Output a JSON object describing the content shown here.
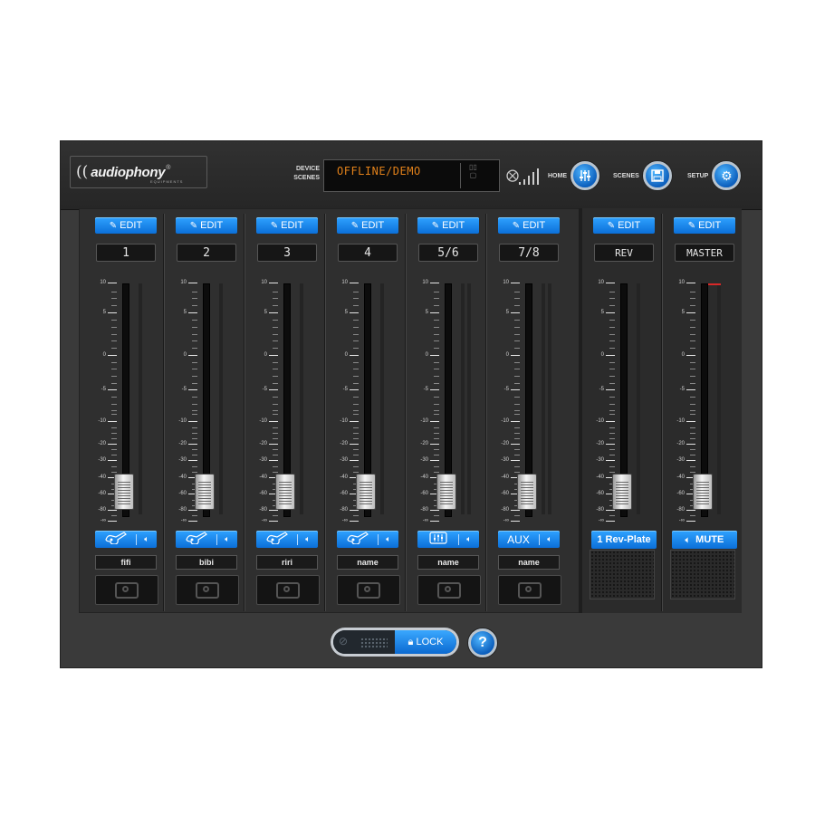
{
  "brand": {
    "logo_mark": "((",
    "logo_text": "audiophony",
    "logo_reg": "®",
    "logo_sub": "EQUIPMENTS"
  },
  "header": {
    "device_label_1": "DEVICE",
    "device_label_2": "SCENES",
    "display_text": "OFFLINE/DEMO",
    "bluetooth_icon": "⨂",
    "home_label": "HOME",
    "scenes_label": "SCENES",
    "setup_label": "SETUP"
  },
  "edit_label": "EDIT",
  "scale_labels": [
    "10",
    "5",
    "0",
    "-5",
    "-10",
    "-20",
    "-30",
    "-40",
    "-60",
    "-80",
    "-∞"
  ],
  "channels": [
    {
      "name": "1",
      "source": "guitar-icon",
      "label": "fifi"
    },
    {
      "name": "2",
      "source": "guitar-icon",
      "label": "bibi"
    },
    {
      "name": "3",
      "source": "guitar-icon",
      "label": "riri"
    },
    {
      "name": "4",
      "source": "guitar-icon",
      "label": "name"
    },
    {
      "name": "5/6",
      "source": "mixer-icon",
      "label": "name"
    },
    {
      "name": "7/8",
      "source": "AUX",
      "label": "name"
    }
  ],
  "fx": {
    "name": "REV",
    "preset": "1 Rev-Plate"
  },
  "master": {
    "name": "MASTER",
    "mute_label": "MUTE"
  },
  "fader_level_db": "-∞",
  "footer": {
    "lock_label": "LOCK",
    "help_label": "?"
  },
  "colors": {
    "accent": "#1a8cf0",
    "display_text": "#e2811a",
    "peak": "#d82828"
  }
}
